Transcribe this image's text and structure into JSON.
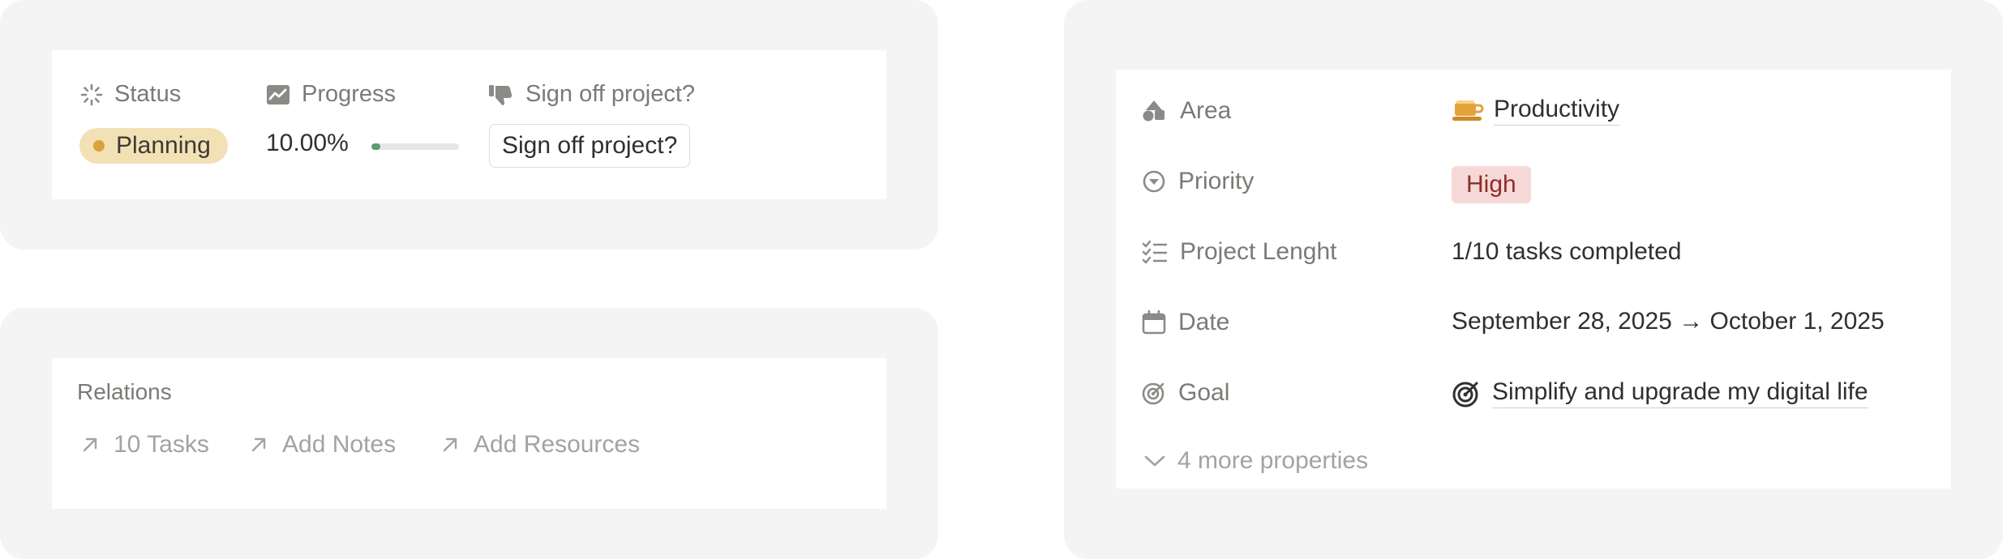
{
  "status_card": {
    "status": {
      "label": "Status",
      "icon": "loader-icon",
      "value": "Planning",
      "color": "#f3e1b6",
      "dot_color": "#d9a23b"
    },
    "progress": {
      "label": "Progress",
      "icon": "chart-icon",
      "value_text": "10.00%",
      "value": 0.1,
      "color": "#5a9b73"
    },
    "signoff": {
      "label": "Sign off project?",
      "icon": "thumbs-down-icon",
      "button_label": "Sign off project?"
    }
  },
  "relations_card": {
    "title": "Relations",
    "links": [
      {
        "label": "10 Tasks",
        "icon": "arrow-up-right-icon"
      },
      {
        "label": "Add Notes",
        "icon": "arrow-up-right-icon"
      },
      {
        "label": "Add Resources",
        "icon": "arrow-up-right-icon"
      }
    ]
  },
  "properties": {
    "area": {
      "label": "Area",
      "icon": "shapes-icon",
      "value": "Productivity",
      "value_icon": "coffee-icon"
    },
    "priority": {
      "label": "Priority",
      "icon": "target-down-icon",
      "value": "High",
      "color": "#f6d9d7"
    },
    "project_length": {
      "label": "Project Lenght",
      "icon": "checklist-icon",
      "value": "1/10 tasks completed"
    },
    "date": {
      "label": "Date",
      "icon": "calendar-icon",
      "value": "September 28, 2025 → October 1, 2025"
    },
    "goal": {
      "label": "Goal",
      "icon": "goal-icon",
      "value": "Simplify and upgrade my digital life",
      "value_icon": "bullseye-icon"
    },
    "more": {
      "label": "4 more properties",
      "icon": "chevron-down-icon"
    }
  }
}
